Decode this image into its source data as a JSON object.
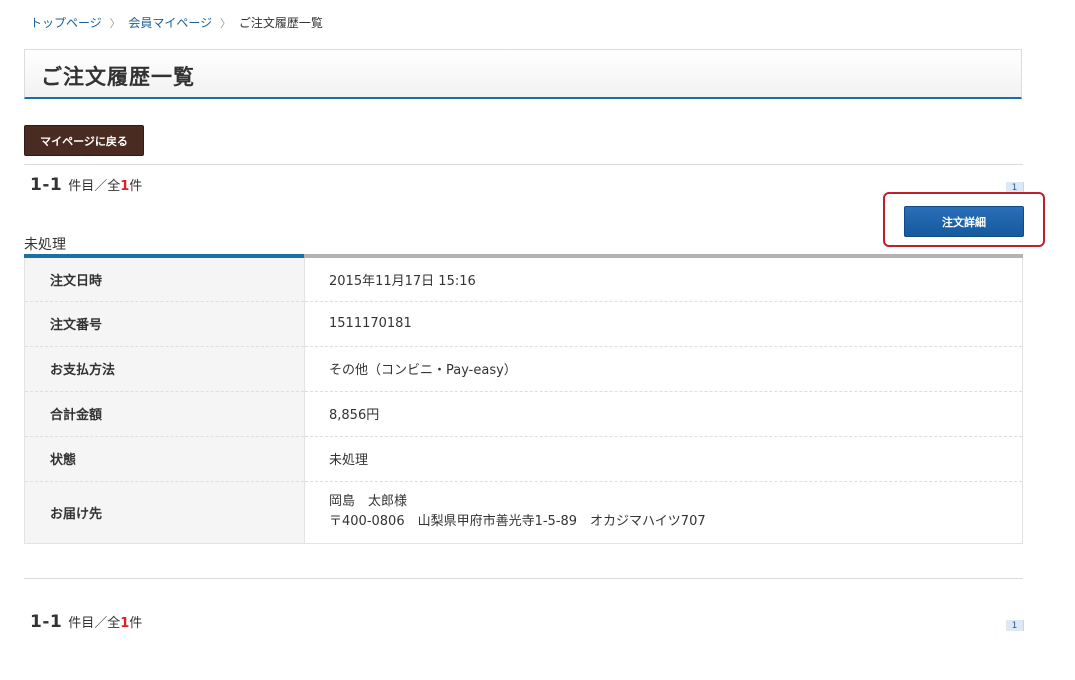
{
  "breadcrumb": {
    "items": [
      "トップページ",
      "会員マイページ",
      "ご注文履歴一覧"
    ],
    "separator": "〉"
  },
  "page_title": "ご注文履歴一覧",
  "back_button": "マイページに戻る",
  "pagination": {
    "range": "1-1",
    "text_mid": "件目／全",
    "total": "1",
    "text_end": "件",
    "page": "1"
  },
  "order": {
    "status_label": "未処理",
    "detail_button": "注文詳細",
    "rows": [
      {
        "label": "注文日時",
        "value": "2015年11月17日 15:16"
      },
      {
        "label": "注文番号",
        "value": "1511170181"
      },
      {
        "label": "お支払方法",
        "value": "その他（コンビニ・Pay-easy）"
      },
      {
        "label": "合計金額",
        "value": "8,856円"
      },
      {
        "label": "状態",
        "value": "未処理"
      },
      {
        "label": "お届け先",
        "value": "岡島　太郎様",
        "value2": "〒400-0806　山梨県甲府市善光寺1-5-89　オカジマハイツ707"
      }
    ]
  },
  "colors": {
    "accent": "#1a6fa8",
    "back_button": "#4a2b22",
    "detail_button": "#155a9d",
    "highlight": "#c0202a",
    "total_count": "#dd2222"
  }
}
